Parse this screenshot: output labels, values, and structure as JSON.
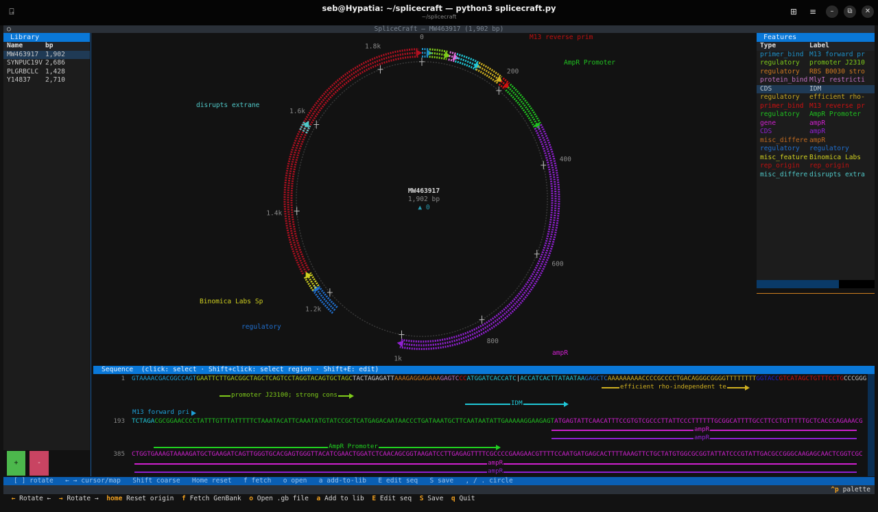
{
  "os": {
    "title": "seb@Hypatia: ~/splicecraft — python3 splicecraft.py",
    "subtitle": "~/splicecraft",
    "restore_glyph": "⧉",
    "close_glyph": "✕",
    "min_glyph": "–",
    "grid_glyph": "⊞",
    "menu_glyph": "≡",
    "term_glyph": "⍈"
  },
  "app": {
    "title": "SpliceCraft — MW463917  (1,902 bp)",
    "circle_glyph": "○"
  },
  "library": {
    "title": "Library",
    "columns": [
      "Name",
      "bp"
    ],
    "rows": [
      {
        "name": "MW463917",
        "bp": "1,902",
        "selected": true
      },
      {
        "name": "SYNPUC19V",
        "bp": "2,686"
      },
      {
        "name": "PLGRBCLC",
        "bp": "1,428"
      },
      {
        "name": "Y14837",
        "bp": "2,710"
      }
    ],
    "add_label": "+",
    "remove_label": "-"
  },
  "features": {
    "title": "Features",
    "columns": [
      "Type",
      "Label"
    ],
    "rows": [
      {
        "type": "primer_bind",
        "label": "M13 forward pr",
        "color": "#1e90c8"
      },
      {
        "type": "regulatory",
        "label": "promoter J2310",
        "color": "#7fcc1a"
      },
      {
        "type": "regulatory",
        "label": "RBS B0030 stro",
        "color": "#d07a20"
      },
      {
        "type": "protein_bind",
        "label": "MlyI restricti",
        "color": "#c070c0"
      },
      {
        "type": "CDS",
        "label": "IDM",
        "color": "#c0c8d0",
        "selected": true
      },
      {
        "type": "regulatory",
        "label": "efficient rho-",
        "color": "#c8a820"
      },
      {
        "type": "primer_bind",
        "label": "M13 reverse pr",
        "color": "#d01010"
      },
      {
        "type": "regulatory",
        "label": "AmpR Promoter",
        "color": "#20c020"
      },
      {
        "type": "gene",
        "label": "ampR",
        "color": "#d020d0"
      },
      {
        "type": "CDS",
        "label": "ampR",
        "color": "#9020d0"
      },
      {
        "type": "misc_differe",
        "label": "ampR",
        "color": "#c06a20"
      },
      {
        "type": "regulatory",
        "label": "regulatory",
        "color": "#2070d0"
      },
      {
        "type": "misc_feature",
        "label": "Binomica Labs",
        "color": "#d0d020"
      },
      {
        "type": "rep_origin",
        "label": "rep_origin",
        "color": "#c01010"
      },
      {
        "type": "misc_differe",
        "label": "disrupts extra",
        "color": "#50c8c8"
      }
    ],
    "scroll_fraction": 0.7
  },
  "map": {
    "name": "MW463917",
    "length_label": "1,902 bp",
    "length": 1902,
    "origin_label": "▲ 0",
    "ticks": [
      {
        "bp": 0,
        "label": "0"
      },
      {
        "bp": 200,
        "label": "200"
      },
      {
        "bp": 400,
        "label": "400"
      },
      {
        "bp": 600,
        "label": "600"
      },
      {
        "bp": 800,
        "label": "800"
      },
      {
        "bp": 1000,
        "label": "1k"
      },
      {
        "bp": 1200,
        "label": "1.2k"
      },
      {
        "bp": 1400,
        "label": "1.4k"
      },
      {
        "bp": 1600,
        "label": "1.6k"
      },
      {
        "bp": 1800,
        "label": "1.8k"
      }
    ],
    "arcs": [
      {
        "start": 0,
        "end": 17,
        "color": "#1e90c8"
      },
      {
        "start": 17,
        "end": 58,
        "color": "#7fcc1a"
      },
      {
        "start": 62,
        "end": 78,
        "color": "#e070e0"
      },
      {
        "start": 78,
        "end": 130,
        "color": "#20c8d8"
      },
      {
        "start": 130,
        "end": 188,
        "color": "#d0b020"
      },
      {
        "start": 192,
        "end": 209,
        "color": "#d01010"
      },
      {
        "start": 212,
        "end": 318,
        "color": "#20c020"
      },
      {
        "start": 318,
        "end": 1000,
        "color": "#9020d0"
      },
      {
        "start": 1165,
        "end": 1228,
        "color": "#2070d0"
      },
      {
        "start": 1228,
        "end": 1262,
        "color": "#d0d020"
      },
      {
        "start": 1268,
        "end": 1895,
        "color": "#b01020"
      },
      {
        "start": 1572,
        "end": 1590,
        "color": "#50c8c8"
      }
    ],
    "labels": {
      "m13_reverse": "M13 reverse prim",
      "ampr_promoter": "AmpR Promoter",
      "disrupts": "disrupts extrane",
      "binomica": "Binomica Labs Sp",
      "regulatory": "regulatory",
      "ampr": "ampR"
    }
  },
  "sequence": {
    "header": "Sequence  (click: select · Shift+click: select region · Shift+E: edit)",
    "rows": [
      {
        "start": "1",
        "segments": [
          {
            "t": "GTAAAACGACGGCCAGT",
            "c": "#1ea0d8"
          },
          {
            "t": "GAATTCTTGACGGCTAGCTCAGTCCTAGGTACAGTGCTAGC",
            "c": "#a8c820"
          },
          {
            "t": "TACTAGAGATT",
            "c": "#d0d0d0"
          },
          {
            "t": "AAAGAGGAGAAA",
            "c": "#d07a20"
          },
          {
            "t": "GAGTC",
            "c": "#c070c0"
          },
          {
            "t": "CC",
            "c": "#d01010"
          },
          {
            "t": "ATGGATCACCATC",
            "c": "#20c8d8"
          },
          {
            "t": "|",
            "c": "#d0d0d0"
          },
          {
            "t": "ACCATCACTTATAATAA",
            "c": "#20c8d8"
          },
          {
            "t": "GAGCTC",
            "c": "#2070d0"
          },
          {
            "t": "AAAAAAAAACCCCGCCCCTGACAGGGCGGGGTTTTTTTT",
            "c": "#d0b020"
          },
          {
            "t": "GGTACC",
            "c": "#2020d0"
          },
          {
            "t": "GTCATAGCTGTTTCCTG",
            "c": "#d01010"
          },
          {
            "t": "CCCGGG",
            "c": "#c0c0c0"
          }
        ]
      },
      {
        "start": "193",
        "segments": [
          {
            "t": "TCTAGA",
            "c": "#20c8d8"
          },
          {
            "t": "CGCGGAACCCCTATTTGTTTATTTTTCTAAATACATTCAAATATGTATCCGCTCATGAGACAATAACCCTGATAAATGCTTCAATAATATTGAAAAAGGAAGAGT",
            "c": "#20c020"
          },
          {
            "t": "ATGAGTATTCAACATTTCCGTGTCGCCCTTATTCCCTTTTTTGCGGCATTTTGCCTTCCTGTTTTTGCTCACCCAGAAACG",
            "c": "#d020d0"
          }
        ]
      },
      {
        "start": "385",
        "segments": [
          {
            "t": "CTGGTGAAAGTAAAAGATGCTGAAGATCAGTTGGGTGCACGAGTGGGTTACATCGAACTGGATCTCAACAGCGGTAAGATCCTTGAGAGTTTTCGCCCCGAAGAACGTTTTCCAATGATGAGCACTTTTAAAGTTCTGCTATGTGGCGCGGTATTATCCCGTATTGACGCCGGGCAAGAGCAACTCGGTCGC",
            "c": "#d020d0"
          }
        ]
      }
    ],
    "annotations": {
      "promoter": "promoter J23100; strong cons",
      "terminator": "efficient rho-independent te",
      "idm": "IDM",
      "m13fwd": "M13 forward pri",
      "ampr_promoter": "AmpR Promoter",
      "ampr": "ampR"
    }
  },
  "keys_bar": "[ ] rotate   ← → cursor/map   Shift coarse   Home reset   f fetch   o open   a add-to-lib   E edit seq   S save   , / . circle",
  "footer": {
    "items": [
      {
        "key": "←",
        "label": "Rotate ←"
      },
      {
        "key": "→",
        "label": "Rotate →"
      },
      {
        "key": "home",
        "label": "Reset origin"
      },
      {
        "key": "f",
        "label": "Fetch GenBank"
      },
      {
        "key": "o",
        "label": "Open .gb file"
      },
      {
        "key": "a",
        "label": "Add to lib"
      },
      {
        "key": "E",
        "label": "Edit seq"
      },
      {
        "key": "S",
        "label": "Save"
      },
      {
        "key": "q",
        "label": "Quit"
      }
    ],
    "palette_key": "^p",
    "palette_label": "palette"
  }
}
